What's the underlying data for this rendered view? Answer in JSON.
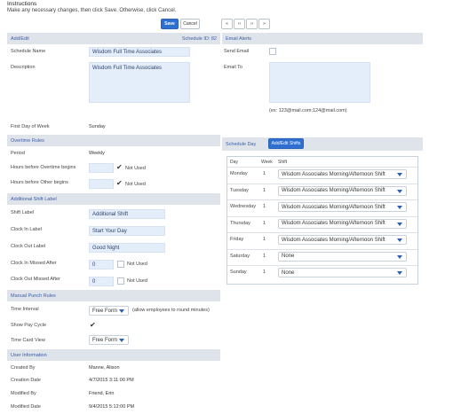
{
  "instructions": {
    "title": "Instructions",
    "text": "Make any necessary changes, then click Save. Otherwise, click Cancel."
  },
  "toolbar": {
    "save": "Save",
    "cancel": "Cancel",
    "first": "«",
    "prev": "‹‹",
    "next": "››",
    "last": "»"
  },
  "addedit": {
    "header": "Add/Edit",
    "schedule_id_label": "Schedule ID: 82",
    "schedule_name_label": "Schedule Name",
    "schedule_name": "Wisdom Full Time Associates",
    "description_label": "Description",
    "description": "Wisdom Full Time Associates",
    "first_day_label": "First Day of Week",
    "first_day": "Sunday"
  },
  "overtime": {
    "header": "Overtime Rules",
    "period_label": "Period",
    "period": "Weekly",
    "hours_before_ot_label": "Hours before Overtime begins",
    "hours_before_dt_label": "Hours before Other begins",
    "not_used": "Not Used"
  },
  "additional_shift": {
    "header": "Additional Shift Label",
    "shift_label_label": "Shift Label",
    "shift_label": "Additional Shift",
    "clock_in_label": "Clock In Label",
    "clock_in": "Start Your Day",
    "clock_out_label": "Clock Out Label",
    "clock_out": "Good Night",
    "clock_in_missed_label": "Clock In Missed After",
    "clock_in_missed": "0",
    "clock_out_missed_label": "Clock Out Missed After",
    "clock_out_missed": "0",
    "not_used": "Not Used"
  },
  "manual_punch": {
    "header": "Manual Punch Rules",
    "time_interval_label": "Time Interval",
    "time_interval": "Free Form",
    "time_interval_note": "(allow employees to round minutes)",
    "show_pay_cycle_label": "Show Pay Cycle",
    "time_card_view_label": "Time Card View",
    "time_card_view": "Free Form"
  },
  "user_info": {
    "header": "User Information",
    "created_by_label": "Created By",
    "created_by": "Manne, Alison",
    "creation_date_label": "Creation Date",
    "creation_date": "4/7/2015 3:11:00 PM",
    "modified_by_label": "Modified By",
    "modified_by": "Friend, Erin",
    "modified_date_label": "Modified Date",
    "modified_date": "9/4/2015 5:12:00 PM"
  },
  "email_alerts": {
    "header": "Email Alerts",
    "send_email_label": "Send Email",
    "email_to_label": "Email To",
    "email_hint": "(ex: 123@mail.com;124@mail.com)"
  },
  "schedule_day": {
    "header": "Schedule Day",
    "add_edit_shifts": "Add/Edit Shifts",
    "col_day": "Day",
    "col_week": "Week",
    "col_shift": "Shift",
    "rows": [
      {
        "day": "Monday",
        "week": "1",
        "shift": "Wisdom Associates Morning/Afternoon Shift"
      },
      {
        "day": "Tuesday",
        "week": "1",
        "shift": "Wisdom Associates Morning/Afternoon Shift"
      },
      {
        "day": "Wednesday",
        "week": "1",
        "shift": "Wisdom Associates Morning/Afternoon Shift"
      },
      {
        "day": "Thursday",
        "week": "1",
        "shift": "Wisdom Associates Morning/Afternoon Shift"
      },
      {
        "day": "Friday",
        "week": "1",
        "shift": "Wisdom Associates Morning/Afternoon Shift"
      },
      {
        "day": "Saturday",
        "week": "1",
        "shift": "None"
      },
      {
        "day": "Sunday",
        "week": "1",
        "shift": "None"
      }
    ]
  }
}
